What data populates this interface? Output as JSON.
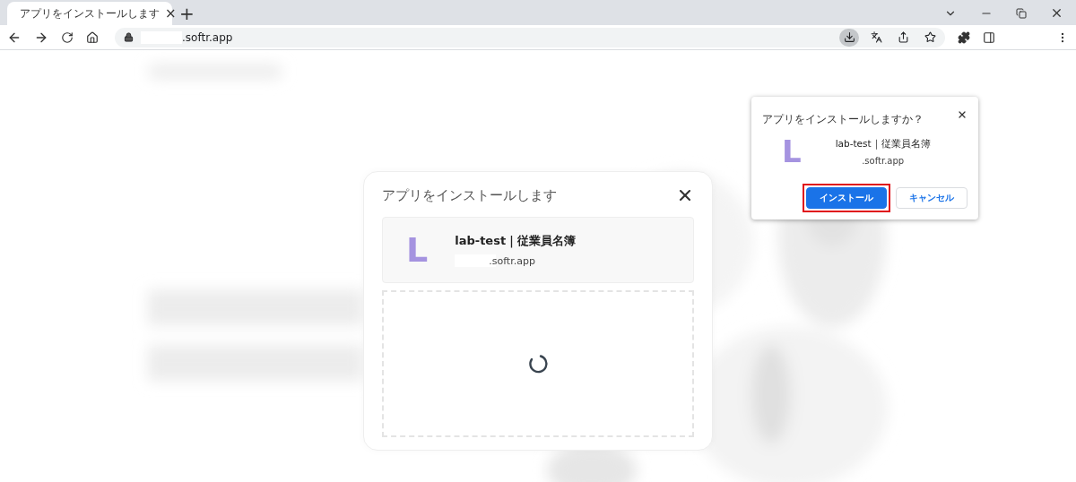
{
  "browser": {
    "tab": {
      "title": "アプリをインストールします",
      "close": "×"
    },
    "new_tab": "+",
    "address": ".softr.app",
    "toolbar_icons": [
      {
        "kind": "install",
        "selected": true
      },
      {
        "kind": "translate",
        "selected": false
      },
      {
        "kind": "share",
        "selected": false
      },
      {
        "kind": "star",
        "selected": false
      }
    ]
  },
  "install_bubble": {
    "title": "アプリをインストールしますか？",
    "app_letter": "L",
    "app_name": "lab-test｜従業員名簿",
    "app_domain": ".softr.app",
    "buttons": [
      {
        "label": "インストール",
        "kind": "primary",
        "highlighted": true
      },
      {
        "label": "キャンセル",
        "kind": "secondary",
        "highlighted": false
      }
    ]
  },
  "dialog": {
    "title": "アプリをインストールします",
    "app_letter": "L",
    "app_name": "lab-test｜従業員名簿",
    "app_domain": ".softr.app",
    "loading": true
  }
}
